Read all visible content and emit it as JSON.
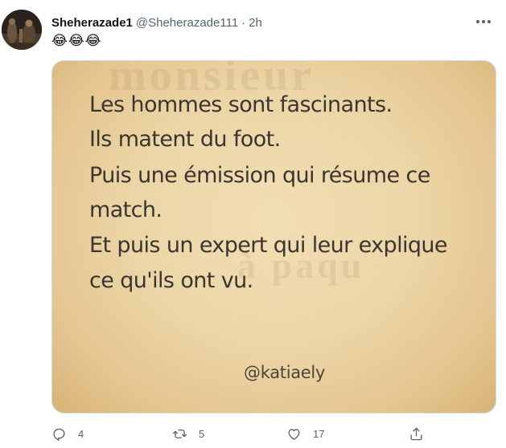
{
  "tweet": {
    "display_name": "Sheherazade1",
    "handle": "@Sheherazade111",
    "separator": "·",
    "time": "2h",
    "text": "😂😂😂"
  },
  "media": {
    "lines": [
      "Les hommes sont fascinants.",
      "Ils matent du foot.",
      "Puis une émission qui résume ce",
      "match.",
      "Et puis un expert qui leur explique",
      "ce qu'ils ont vu."
    ],
    "signature": "@katiaely"
  },
  "actions": {
    "reply_count": "4",
    "retweet_count": "5",
    "like_count": "17"
  },
  "icons": {
    "more": "more-icon",
    "reply": "reply-icon",
    "retweet": "retweet-icon",
    "like": "heart-icon",
    "share": "share-icon"
  },
  "colors": {
    "text": "#0f1419",
    "secondary": "#536471",
    "border": "#cfd9de",
    "image_background": "#ecd6a7"
  }
}
